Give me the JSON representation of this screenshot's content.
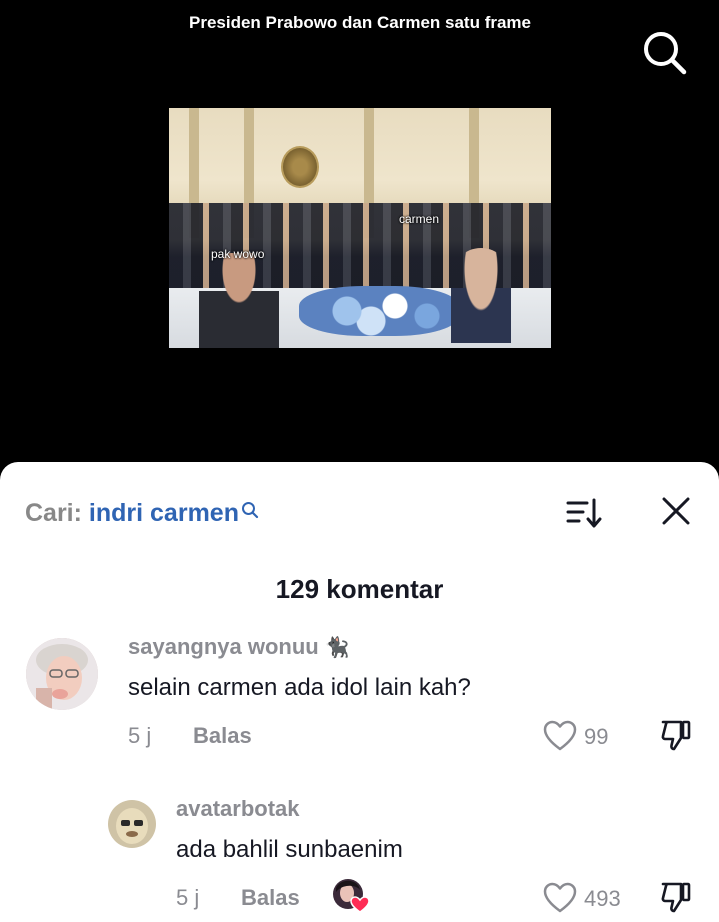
{
  "video": {
    "title": "Presiden Prabowo dan Carmen satu frame",
    "captions": {
      "left": "pak wowo",
      "right": "carmen"
    }
  },
  "comments_panel": {
    "search_prefix": "Cari:",
    "search_term": "indri carmen",
    "count_label": "129 komentar",
    "comments": [
      {
        "username": "sayangnya wonuu",
        "username_emoji": "🐈‍⬛",
        "text": "selain carmen ada idol lain kah?",
        "time": "5 j",
        "reply_label": "Balas",
        "likes": "99"
      },
      {
        "username": "avatarbotak",
        "text": "ada bahlil sunbaenim",
        "time": "5 j",
        "reply_label": "Balas",
        "likes": "493",
        "creator_liked": true
      }
    ]
  },
  "colors": {
    "accent_search": "#2f64b3",
    "text_primary": "#161823",
    "text_secondary": "#8a8b91",
    "heart_badge": "#fe2c55"
  },
  "icons": [
    "search-icon",
    "sort-icon",
    "close-icon",
    "heart-icon",
    "thumbs-down-icon"
  ]
}
